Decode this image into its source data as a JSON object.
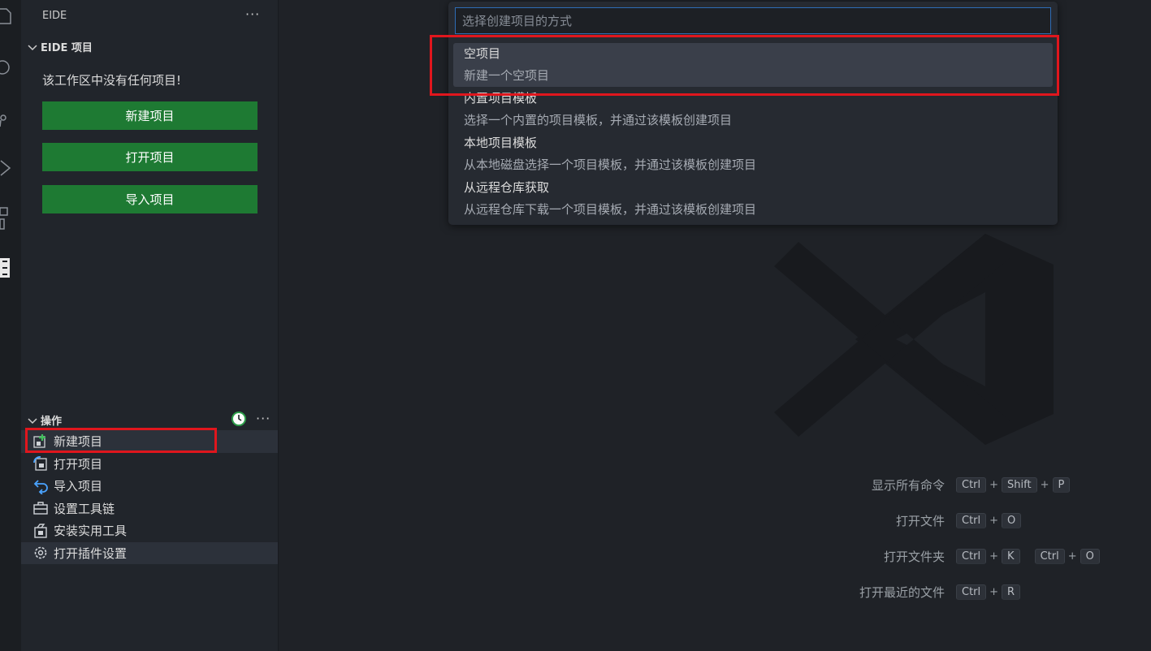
{
  "sidebar": {
    "header": "EIDE",
    "more": "···",
    "projects_section": {
      "title": "EIDE 项目",
      "empty_message": "该工作区中没有任何项目!",
      "buttons": [
        "新建项目",
        "打开项目",
        "导入项目"
      ]
    },
    "ops_section": {
      "title": "操作",
      "items": [
        {
          "label": "新建项目",
          "icon": "new-project-icon"
        },
        {
          "label": "打开项目",
          "icon": "open-project-icon"
        },
        {
          "label": "导入项目",
          "icon": "import-project-icon"
        },
        {
          "label": "设置工具链",
          "icon": "toolbox-icon"
        },
        {
          "label": "安装实用工具",
          "icon": "install-tools-icon"
        },
        {
          "label": "打开插件设置",
          "icon": "gear-icon"
        }
      ]
    }
  },
  "quick_pick": {
    "placeholder": "选择创建项目的方式",
    "items": [
      {
        "label": "空项目",
        "description": "新建一个空项目"
      },
      {
        "label": "内置项目模板",
        "description": "选择一个内置的项目模板，并通过该模板创建项目"
      },
      {
        "label": "本地项目模板",
        "description": "从本地磁盘选择一个项目模板，并通过该模板创建项目"
      },
      {
        "label": "从远程仓库获取",
        "description": "从远程仓库下载一个项目模板，并通过该模板创建项目"
      }
    ]
  },
  "shortcuts": [
    {
      "label": "显示所有命令",
      "keys": [
        "Ctrl",
        "+",
        "Shift",
        "+",
        "P"
      ]
    },
    {
      "label": "打开文件",
      "keys": [
        "Ctrl",
        "+",
        "O"
      ]
    },
    {
      "label": "打开文件夹",
      "keys": [
        "Ctrl",
        "+",
        "K",
        " ",
        "Ctrl",
        "+",
        "O"
      ]
    },
    {
      "label": "打开最近的文件",
      "keys": [
        "Ctrl",
        "+",
        "R"
      ]
    }
  ],
  "colors": {
    "accent_green": "#1e7a33",
    "highlight_red": "#e0161d",
    "focus_blue": "#2e6cb5"
  }
}
